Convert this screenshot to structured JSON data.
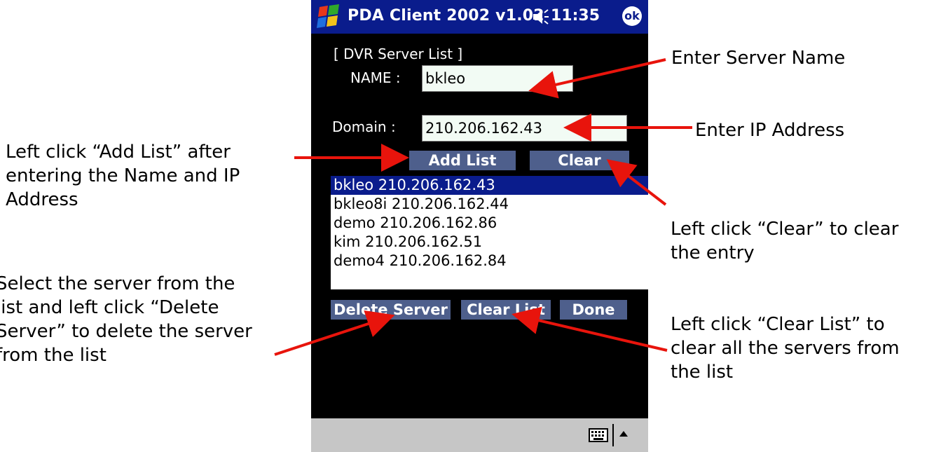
{
  "annotations": {
    "enter_server_name": "Enter Server Name",
    "enter_ip_address": "Enter IP Address",
    "add_list_help": "Left click “Add List” after\nentering the Name and IP\nAddress",
    "clear_help": "Left click “Clear” to clear\nthe entry",
    "delete_help": "Select the server from the\nlist and left click “Delete\nServer” to delete the server\nfrom the list",
    "clear_list_help": "Left click “Clear List” to\nclear all the servers from\nthe list",
    "arrow_color": "#e8140c"
  },
  "pda": {
    "title": "PDA Client 2002 v1.02",
    "time": "11:35",
    "ok_label": "ok",
    "section_label": "[ DVR Server List ]",
    "name_label": "NAME :",
    "name_value": "bkleo",
    "domain_label": "Domain :",
    "domain_value": "210.206.162.43",
    "add_list_label": "Add List",
    "clear_label": "Clear",
    "servers": [
      "bkleo 210.206.162.43",
      "bkleo8i 210.206.162.44",
      "demo 210.206.162.86",
      "kim 210.206.162.51",
      "demo4 210.206.162.84"
    ],
    "delete_server_label": "Delete Server",
    "clear_list_label": "Clear List",
    "done_label": "Done",
    "colors": {
      "titlebar": "#0a1c8c",
      "button": "#4e5f8c",
      "selection": "#0a1c8c",
      "background": "#000000"
    }
  }
}
